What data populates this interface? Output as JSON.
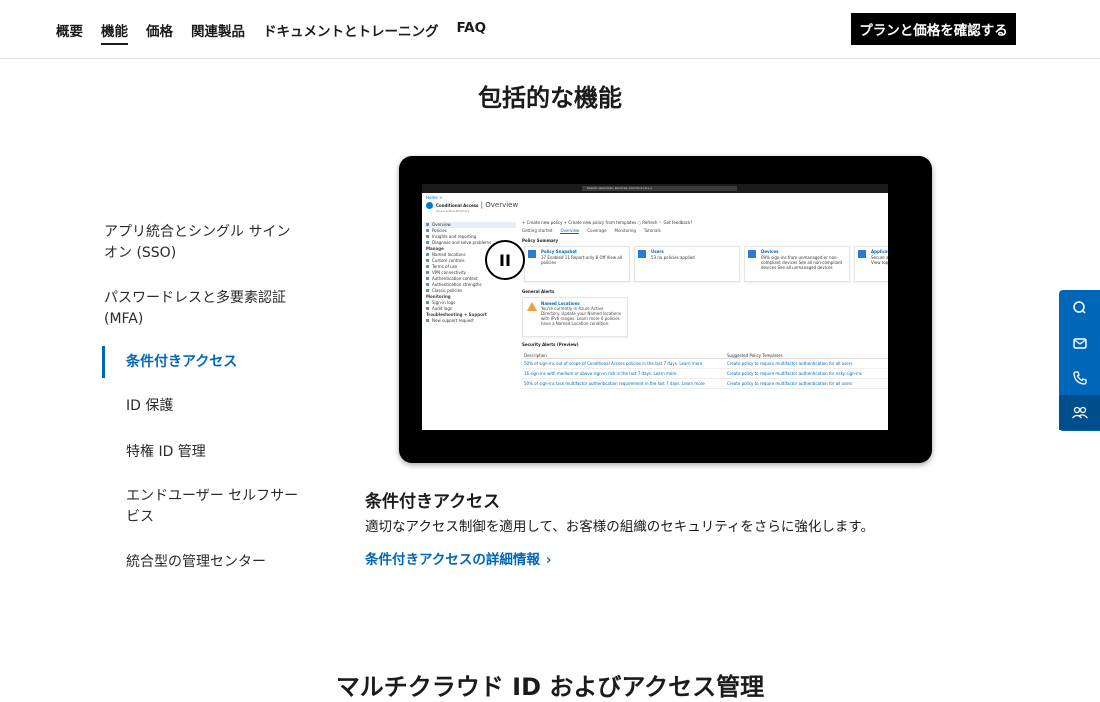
{
  "nav": {
    "links": [
      "概要",
      "機能",
      "価格",
      "関連製品",
      "ドキュメントとトレーニング",
      "FAQ"
    ],
    "active_index": 1,
    "cta": "プランと価格を確認する"
  },
  "section_title": "包括的な機能",
  "feature_nav": [
    "アプリ統合とシングル サインオン (SSO)",
    "パスワードレスと多要素認証 (MFA)",
    "条件付きアクセス",
    "ID 保護",
    "特権 ID 管理",
    "エンドユーザー セルフサービス",
    "統合型の管理センター"
  ],
  "feature_active_index": 2,
  "screenshot": {
    "search": "Search resources, services, and docs (G+/)",
    "breadcrumb": "Home >",
    "title": "Conditional Access",
    "title_suffix": " | Overview",
    "org": "Azure Active Directory",
    "sidebar": [
      {
        "label": "Overview",
        "type": "item",
        "selected": true
      },
      {
        "label": "Policies",
        "type": "item"
      },
      {
        "label": "Insights and reporting",
        "type": "item"
      },
      {
        "label": "Diagnose and solve problems",
        "type": "item"
      },
      {
        "label": "Manage",
        "type": "group"
      },
      {
        "label": "Named locations",
        "type": "item"
      },
      {
        "label": "Custom controls",
        "type": "item"
      },
      {
        "label": "Terms of use",
        "type": "item"
      },
      {
        "label": "VPN connectivity",
        "type": "item"
      },
      {
        "label": "Authentication context",
        "type": "item"
      },
      {
        "label": "Authentication strengths",
        "type": "item"
      },
      {
        "label": "Classic policies",
        "type": "item"
      },
      {
        "label": "Monitoring",
        "type": "group"
      },
      {
        "label": "Sign-in logs",
        "type": "item"
      },
      {
        "label": "Audit logs",
        "type": "item"
      },
      {
        "label": "Troubleshooting + Support",
        "type": "group"
      },
      {
        "label": "New support request",
        "type": "item"
      }
    ],
    "command_bar": "+ Create new policy   + Create new policy from templates   ○ Refresh   ♡ Got feedback?",
    "tabs": [
      "Getting started",
      "Overview",
      "Coverage",
      "Monitoring",
      "Tutorials"
    ],
    "active_tab": 1,
    "policy_summary_heading": "Policy Summary",
    "cards": [
      {
        "title": "Policy Snapshot",
        "value": "37 Enabled  11 Report-only  8 Off  View all policies"
      },
      {
        "title": "Users",
        "value": "53 no policies applied"
      },
      {
        "title": "Devices",
        "value": "09% sign-ins from unmanaged or non-compliant devices  See all non-compliant devices  See all unmanaged devices"
      },
      {
        "title": "Applications",
        "value": "Secure a list of applications with policies  View top applications"
      }
    ],
    "alerts_heading": "General Alerts",
    "alert": {
      "title": "Named Locations",
      "body": "You're currently in Azure Active Directory. Update your Named locations with IPv6 ranges. Learn more  0 policies have a Named Location condition."
    },
    "security_heading": "Security Alerts (Preview)",
    "table_headers": [
      "Description",
      "Suggested Policy Templates"
    ],
    "table_rows": [
      [
        "50% of sign-ins out of scope of Conditional Access policies in the last 7 days. Learn more",
        "Create policy to require multifactor authentication for all users"
      ],
      [
        "16 sign-ins with medium or above sign-in risk in the last 7 days. Learn more",
        "Create policy to require multifactor authentication for risky sign-ins"
      ],
      [
        "50% of sign-ins lack multifactor authentication requirement in the last 7 days. Learn more",
        "Create policy to require multifactor authentication for all users"
      ]
    ]
  },
  "pause_label": "II",
  "caption": {
    "title": "条件付きアクセス",
    "body": "適切なアクセス制御を適用して、お客様の組織のセキュリティをさらに強化します。",
    "link": "条件付きアクセスの詳細情報",
    "link_chevron": "›"
  },
  "next_section_title": "マルチクラウド ID およびアクセス管理",
  "float_bar": [
    "chat-icon",
    "mail-icon",
    "phone-icon",
    "people-icon"
  ]
}
